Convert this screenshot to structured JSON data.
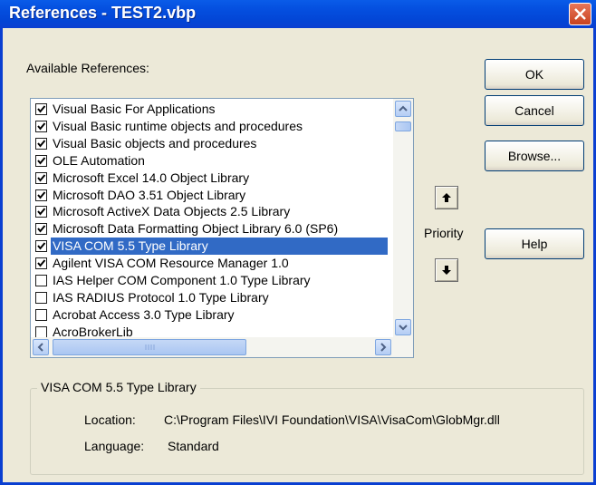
{
  "window": {
    "title": "References - TEST2.vbp"
  },
  "available_label": "Available References:",
  "references": [
    {
      "label": "Visual Basic For Applications",
      "checked": true,
      "selected": false
    },
    {
      "label": "Visual Basic runtime objects and procedures",
      "checked": true,
      "selected": false
    },
    {
      "label": "Visual Basic objects and procedures",
      "checked": true,
      "selected": false
    },
    {
      "label": "OLE Automation",
      "checked": true,
      "selected": false
    },
    {
      "label": "Microsoft Excel 14.0 Object Library",
      "checked": true,
      "selected": false
    },
    {
      "label": "Microsoft DAO 3.51 Object Library",
      "checked": true,
      "selected": false
    },
    {
      "label": "Microsoft ActiveX Data Objects 2.5 Library",
      "checked": true,
      "selected": false
    },
    {
      "label": "Microsoft Data Formatting Object Library 6.0 (SP6)",
      "checked": true,
      "selected": false
    },
    {
      "label": "VISA COM 5.5 Type Library",
      "checked": true,
      "selected": true
    },
    {
      "label": "Agilent VISA COM Resource Manager 1.0",
      "checked": true,
      "selected": false
    },
    {
      "label": "IAS Helper COM Component 1.0 Type Library",
      "checked": false,
      "selected": false
    },
    {
      "label": "IAS RADIUS Protocol 1.0 Type Library",
      "checked": false,
      "selected": false
    },
    {
      "label": "Acrobat Access 3.0 Type Library",
      "checked": false,
      "selected": false
    },
    {
      "label": "AcroBrokerLib",
      "checked": false,
      "selected": false
    }
  ],
  "buttons": {
    "ok": "OK",
    "cancel": "Cancel",
    "browse": "Browse...",
    "help": "Help"
  },
  "priority_label": "Priority",
  "details": {
    "group_title": "VISA COM 5.5 Type Library",
    "location_label": "Location:",
    "location_value": "C:\\Program Files\\IVI Foundation\\VISA\\VisaCom\\GlobMgr.dll",
    "language_label": "Language:",
    "language_value": "Standard"
  },
  "icons": [
    "close-icon",
    "scroll-up-icon",
    "scroll-down-icon",
    "scroll-left-icon",
    "scroll-right-icon",
    "arrow-up-icon",
    "arrow-down-icon",
    "checkmark-icon"
  ]
}
